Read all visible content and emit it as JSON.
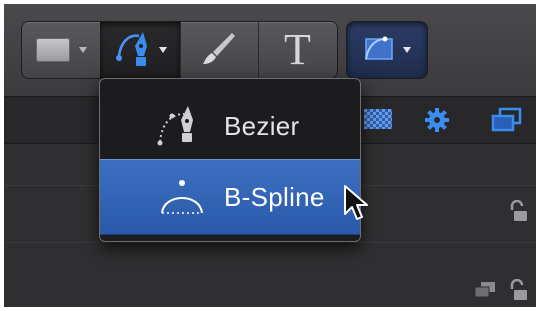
{
  "toolbar": {
    "tools": [
      {
        "name": "rectangle",
        "icon": "rectangle-icon",
        "has_menu": true
      },
      {
        "name": "pen",
        "icon": "pen-nib-icon",
        "has_menu": true,
        "active": true
      },
      {
        "name": "paint-stroke",
        "icon": "brush-icon",
        "has_menu": false
      },
      {
        "name": "text",
        "icon": "text-icon",
        "has_menu": false,
        "glyph": "T"
      }
    ],
    "mask_tool": {
      "icon": "mask-shape-icon",
      "has_menu": true
    }
  },
  "popup_menu": {
    "items": [
      {
        "label": "Bezier",
        "icon": "bezier-pen-icon",
        "highlighted": false
      },
      {
        "label": "B-Spline",
        "icon": "bspline-icon",
        "highlighted": true
      }
    ]
  },
  "colors": {
    "highlight": "#2f62b2",
    "accent_blue": "#3a8cf0",
    "panel_dark": "#1c1c1e"
  }
}
